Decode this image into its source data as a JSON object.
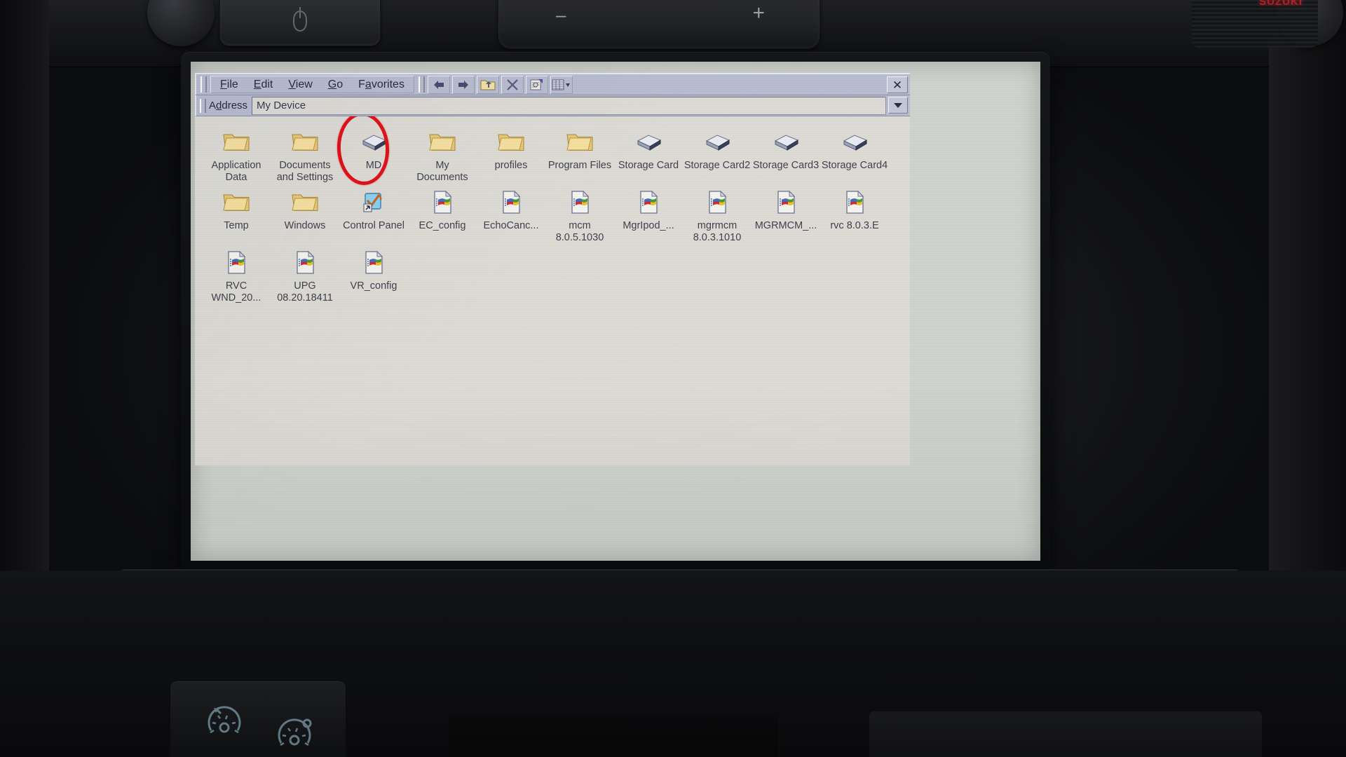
{
  "device": {
    "type": "car-infotainment-head-unit",
    "top_controls": {
      "power_button": "power-icon",
      "volume_minus": "–",
      "volume_plus": "+",
      "brand_led_text": "SUZUKI"
    },
    "bottom_controls": {
      "cruise_control": "speedometer-icon",
      "speed_limiter": "speedometer-limit-icon"
    }
  },
  "window": {
    "close_label": "✕",
    "menu": [
      {
        "label": "File",
        "accel": "F"
      },
      {
        "label": "Edit",
        "accel": "E"
      },
      {
        "label": "View",
        "accel": "V"
      },
      {
        "label": "Go",
        "accel": "G"
      },
      {
        "label": "Favorites",
        "accel": "a"
      }
    ],
    "toolbar": [
      {
        "name": "back-button",
        "icon": "arrow-left-icon"
      },
      {
        "name": "forward-button",
        "icon": "arrow-right-icon"
      },
      {
        "name": "up-folder-button",
        "icon": "folder-up-icon"
      },
      {
        "name": "delete-button",
        "icon": "close-x-icon"
      },
      {
        "name": "properties-button",
        "icon": "properties-icon"
      },
      {
        "name": "view-mode-button",
        "icon": "view-list-icon"
      }
    ],
    "address": {
      "label": "Address",
      "label_accel": "d",
      "value": "My Device",
      "dropdown_icon": "chevron-down-icon"
    }
  },
  "annotation": {
    "circle_color": "#e0121b",
    "circles_item": "MD"
  },
  "files": {
    "rows": [
      [
        {
          "name": "Application Data",
          "icon": "folder-icon"
        },
        {
          "name": "Documents and Settings",
          "icon": "folder-icon"
        },
        {
          "name": "MD",
          "icon": "drive-icon",
          "highlighted": true
        },
        {
          "name": "My Documents",
          "icon": "folder-icon"
        },
        {
          "name": "profiles",
          "icon": "folder-icon"
        },
        {
          "name": "Program Files",
          "icon": "folder-icon"
        },
        {
          "name": "Storage Card",
          "icon": "drive-icon"
        },
        {
          "name": "Storage Card2",
          "icon": "drive-icon"
        },
        {
          "name": "Storage Card3",
          "icon": "drive-icon"
        },
        {
          "name": "Storage Card4",
          "icon": "drive-icon"
        }
      ],
      [
        {
          "name": "Temp",
          "icon": "folder-icon"
        },
        {
          "name": "Windows",
          "icon": "folder-icon"
        },
        {
          "name": "Control Panel",
          "icon": "control-panel-shortcut-icon"
        },
        {
          "name": "EC_config",
          "icon": "exe-file-icon"
        },
        {
          "name": "EchoCanc...",
          "icon": "exe-file-icon"
        },
        {
          "name": "mcm 8.0.5.1030",
          "icon": "exe-file-icon"
        },
        {
          "name": "MgrIpod_...",
          "icon": "exe-file-icon"
        },
        {
          "name": "mgrmcm 8.0.3.1010",
          "icon": "exe-file-icon"
        },
        {
          "name": "MGRMCM_...",
          "icon": "exe-file-icon"
        },
        {
          "name": "rvc 8.0.3.E",
          "icon": "exe-file-icon"
        }
      ],
      [
        {
          "name": "RVC WND_20...",
          "icon": "exe-file-icon"
        },
        {
          "name": "UPG 08.20.18411",
          "icon": "exe-file-icon"
        },
        {
          "name": "VR_config",
          "icon": "exe-file-icon"
        }
      ]
    ]
  },
  "colors": {
    "chrome": "#b8bdd0",
    "pane": "#dddbd4",
    "text": "#41414f",
    "annotation_red": "#e0121b",
    "folder_yellow": "#f0d080"
  }
}
